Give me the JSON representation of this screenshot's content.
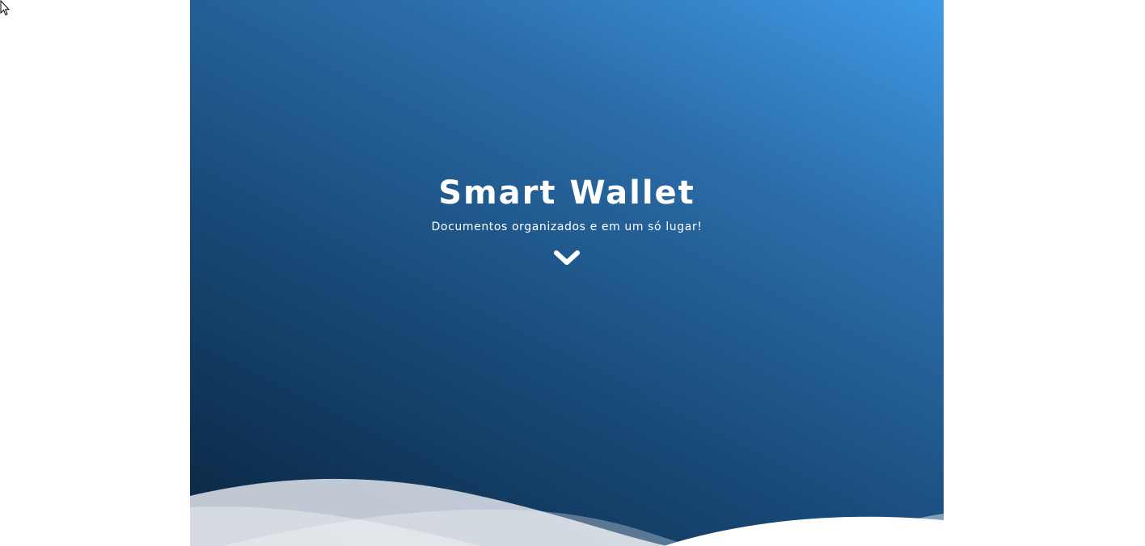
{
  "hero": {
    "title": "Smart Wallet",
    "subtitle": "Documentos organizados e em um só lugar!",
    "scroll_icon": "chevron-down-icon"
  },
  "colors": {
    "gradient_dark": "#0a2540",
    "gradient_mid": "#2b6ca8",
    "gradient_light": "#3f9ae6",
    "text": "#ffffff",
    "page_background": "#ffffff"
  }
}
